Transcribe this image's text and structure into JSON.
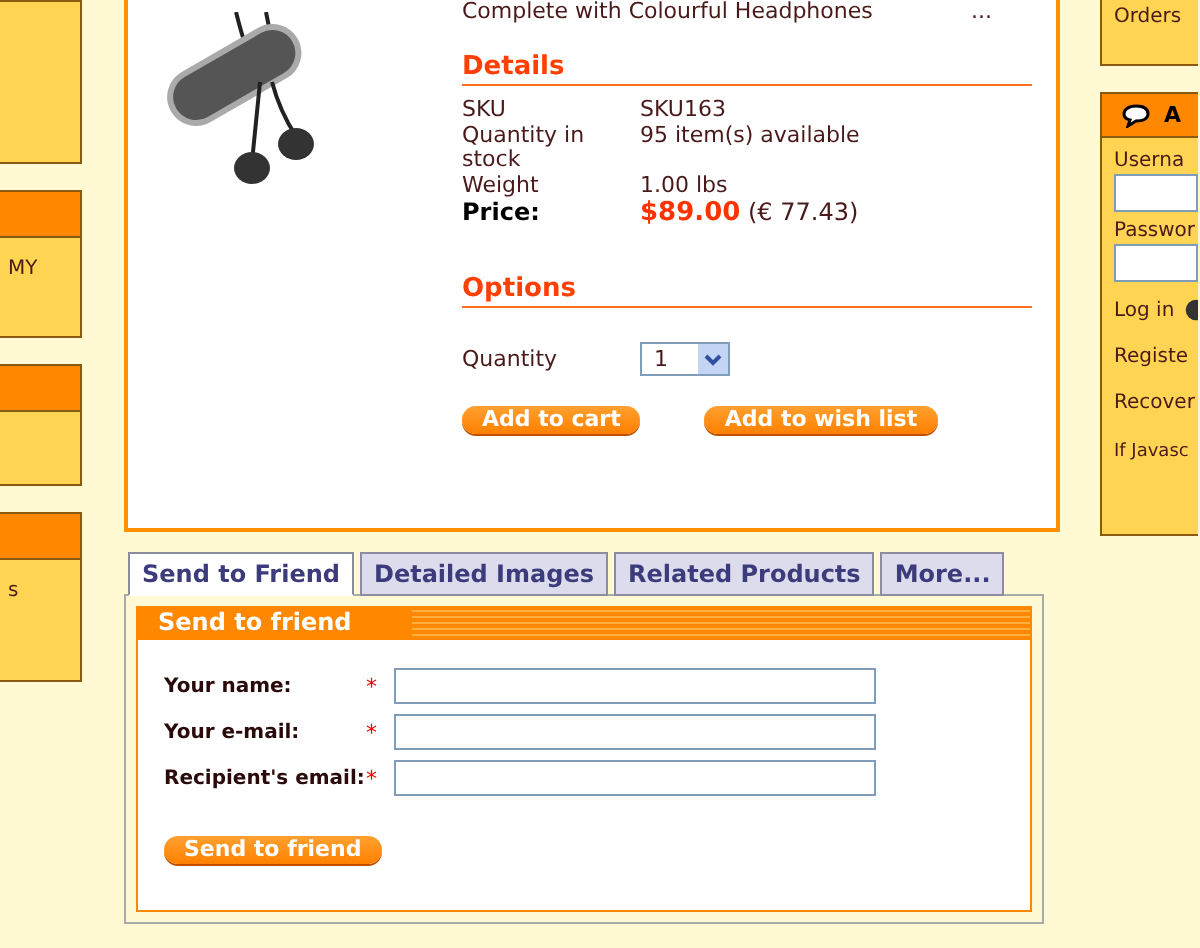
{
  "left_sidebar": {
    "panels": [
      {
        "header": false
      },
      {
        "header": true,
        "text": "MY"
      },
      {
        "header": true
      },
      {
        "header": true,
        "text": "s"
      }
    ]
  },
  "product": {
    "description": "Complete with Colourful Headphones",
    "more": "...",
    "details": {
      "title": "Details",
      "rows": [
        {
          "label": "SKU",
          "value": "SKU163"
        },
        {
          "label": "Quantity in stock",
          "value": "95 item(s) available"
        },
        {
          "label": "Weight",
          "value": "1.00 lbs"
        }
      ],
      "price": {
        "label": "Price:",
        "amount": "$89.00",
        "converted": "(€ 77.43)"
      }
    },
    "options": {
      "title": "Options",
      "quantity_label": "Quantity",
      "quantity_value": "1"
    },
    "buttons": [
      "Add to cart",
      "Add to wish list"
    ]
  },
  "tabs": [
    {
      "label": "Send to Friend",
      "selected": true
    },
    {
      "label": "Detailed Images",
      "selected": false
    },
    {
      "label": "Related Products",
      "selected": false
    },
    {
      "label": "More...",
      "selected": false
    }
  ],
  "send_to_friend": {
    "title": "Send to friend",
    "fields": [
      {
        "label": "Your name:",
        "mark": "*"
      },
      {
        "label": "Your e-mail:",
        "mark": "*"
      },
      {
        "label": "Recipient's email:",
        "mark": "*"
      }
    ],
    "button": "Send to friend"
  },
  "right_sidebar": {
    "orders_link": "Orders",
    "login_box": {
      "title": "A",
      "username_label": "Userna",
      "password_label": "Passwor",
      "login_label": "Log in",
      "links": [
        "Registe",
        "Recover"
      ],
      "note": "If Javasc"
    }
  }
}
